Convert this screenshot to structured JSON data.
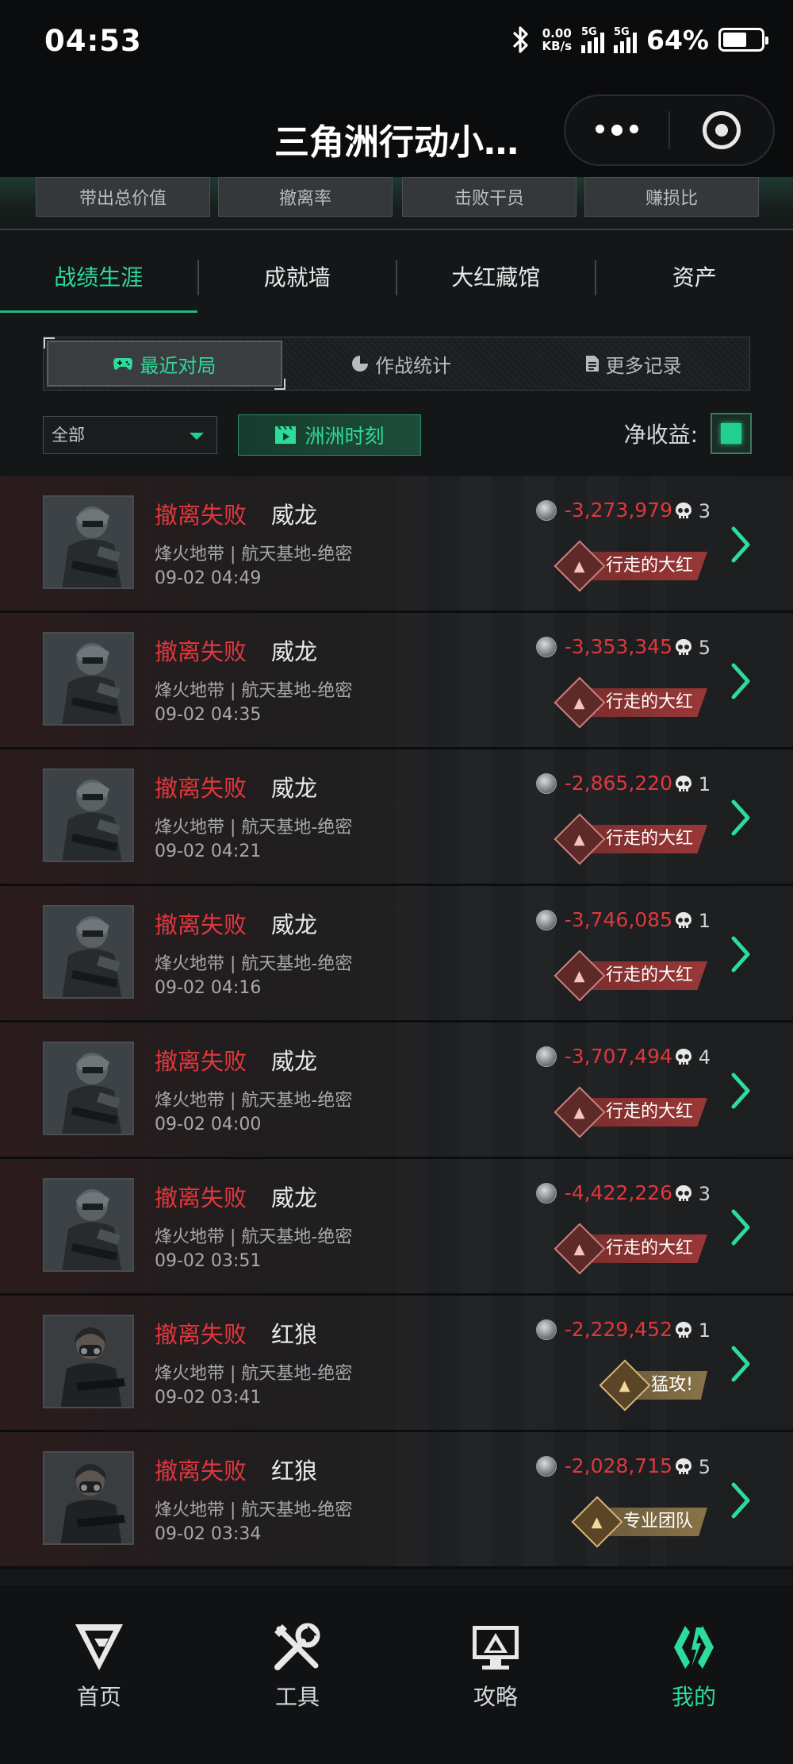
{
  "status_bar": {
    "time": "04:53",
    "net_speed_value": "0.00",
    "net_speed_unit": "KB/s",
    "sim1": "5G",
    "sim2": "5G",
    "battery": "64%",
    "battery_level": 0.64
  },
  "title_bar": {
    "title": "三角洲行动小…"
  },
  "stats_strip": {
    "items": [
      "带出总价值",
      "撤离率",
      "击败干员",
      "赚损比"
    ]
  },
  "tabs": [
    {
      "label": "战绩生涯",
      "active": true
    },
    {
      "label": "成就墙",
      "active": false
    },
    {
      "label": "大红藏馆",
      "active": false
    },
    {
      "label": "资产",
      "active": false
    }
  ],
  "segmented": {
    "options": [
      {
        "label": "最近对局",
        "icon": "gamepad-icon",
        "active": true
      },
      {
        "label": "作战统计",
        "icon": "pie-chart-icon",
        "active": false
      },
      {
        "label": "更多记录",
        "icon": "document-icon",
        "active": false
      }
    ]
  },
  "filter": {
    "dropdown_value": "全部",
    "moments_label": "洲洲时刻",
    "net_label": "净收益:",
    "net_checked": true
  },
  "records": [
    {
      "result": "撤离失败",
      "operator": "威龙",
      "mode": "烽火地带 | 航天基地-绝密",
      "date": "09-02 04:49",
      "value": "-3,273,979",
      "kills": "3",
      "badge": "行走的大红",
      "badge_type": "red",
      "avatar": "weilong"
    },
    {
      "result": "撤离失败",
      "operator": "威龙",
      "mode": "烽火地带 | 航天基地-绝密",
      "date": "09-02 04:35",
      "value": "-3,353,345",
      "kills": "5",
      "badge": "行走的大红",
      "badge_type": "red",
      "avatar": "weilong"
    },
    {
      "result": "撤离失败",
      "operator": "威龙",
      "mode": "烽火地带 | 航天基地-绝密",
      "date": "09-02 04:21",
      "value": "-2,865,220",
      "kills": "1",
      "badge": "行走的大红",
      "badge_type": "red",
      "avatar": "weilong"
    },
    {
      "result": "撤离失败",
      "operator": "威龙",
      "mode": "烽火地带 | 航天基地-绝密",
      "date": "09-02 04:16",
      "value": "-3,746,085",
      "kills": "1",
      "badge": "行走的大红",
      "badge_type": "red",
      "avatar": "weilong"
    },
    {
      "result": "撤离失败",
      "operator": "威龙",
      "mode": "烽火地带 | 航天基地-绝密",
      "date": "09-02 04:00",
      "value": "-3,707,494",
      "kills": "4",
      "badge": "行走的大红",
      "badge_type": "red",
      "avatar": "weilong"
    },
    {
      "result": "撤离失败",
      "operator": "威龙",
      "mode": "烽火地带 | 航天基地-绝密",
      "date": "09-02 03:51",
      "value": "-4,422,226",
      "kills": "3",
      "badge": "行走的大红",
      "badge_type": "red",
      "avatar": "weilong"
    },
    {
      "result": "撤离失败",
      "operator": "红狼",
      "mode": "烽火地带 | 航天基地-绝密",
      "date": "09-02 03:41",
      "value": "-2,229,452",
      "kills": "1",
      "badge": "猛攻!",
      "badge_type": "gold",
      "avatar": "honglang"
    },
    {
      "result": "撤离失败",
      "operator": "红狼",
      "mode": "烽火地带 | 航天基地-绝密",
      "date": "09-02 03:34",
      "value": "-2,028,715",
      "kills": "5",
      "badge": "专业团队",
      "badge_type": "gold",
      "avatar": "honglang"
    }
  ],
  "bottom_nav": [
    {
      "label": "首页",
      "icon": "home-logo-icon",
      "active": false
    },
    {
      "label": "工具",
      "icon": "tools-icon",
      "active": false
    },
    {
      "label": "攻略",
      "icon": "guide-icon",
      "active": false
    },
    {
      "label": "我的",
      "icon": "profile-icon",
      "active": true
    }
  ],
  "colors": {
    "accent": "#2ddb9a",
    "fail_red": "#e0373d",
    "bg": "#141618"
  }
}
